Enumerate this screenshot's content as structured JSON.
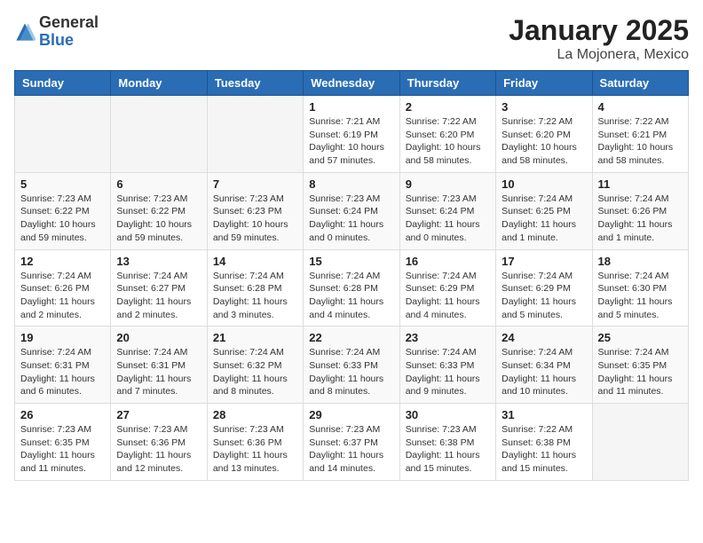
{
  "logo": {
    "general": "General",
    "blue": "Blue"
  },
  "title": "January 2025",
  "subtitle": "La Mojonera, Mexico",
  "days_of_week": [
    "Sunday",
    "Monday",
    "Tuesday",
    "Wednesday",
    "Thursday",
    "Friday",
    "Saturday"
  ],
  "weeks": [
    [
      {
        "day": "",
        "info": ""
      },
      {
        "day": "",
        "info": ""
      },
      {
        "day": "",
        "info": ""
      },
      {
        "day": "1",
        "info": "Sunrise: 7:21 AM\nSunset: 6:19 PM\nDaylight: 10 hours and 57 minutes."
      },
      {
        "day": "2",
        "info": "Sunrise: 7:22 AM\nSunset: 6:20 PM\nDaylight: 10 hours and 58 minutes."
      },
      {
        "day": "3",
        "info": "Sunrise: 7:22 AM\nSunset: 6:20 PM\nDaylight: 10 hours and 58 minutes."
      },
      {
        "day": "4",
        "info": "Sunrise: 7:22 AM\nSunset: 6:21 PM\nDaylight: 10 hours and 58 minutes."
      }
    ],
    [
      {
        "day": "5",
        "info": "Sunrise: 7:23 AM\nSunset: 6:22 PM\nDaylight: 10 hours and 59 minutes."
      },
      {
        "day": "6",
        "info": "Sunrise: 7:23 AM\nSunset: 6:22 PM\nDaylight: 10 hours and 59 minutes."
      },
      {
        "day": "7",
        "info": "Sunrise: 7:23 AM\nSunset: 6:23 PM\nDaylight: 10 hours and 59 minutes."
      },
      {
        "day": "8",
        "info": "Sunrise: 7:23 AM\nSunset: 6:24 PM\nDaylight: 11 hours and 0 minutes."
      },
      {
        "day": "9",
        "info": "Sunrise: 7:23 AM\nSunset: 6:24 PM\nDaylight: 11 hours and 0 minutes."
      },
      {
        "day": "10",
        "info": "Sunrise: 7:24 AM\nSunset: 6:25 PM\nDaylight: 11 hours and 1 minute."
      },
      {
        "day": "11",
        "info": "Sunrise: 7:24 AM\nSunset: 6:26 PM\nDaylight: 11 hours and 1 minute."
      }
    ],
    [
      {
        "day": "12",
        "info": "Sunrise: 7:24 AM\nSunset: 6:26 PM\nDaylight: 11 hours and 2 minutes."
      },
      {
        "day": "13",
        "info": "Sunrise: 7:24 AM\nSunset: 6:27 PM\nDaylight: 11 hours and 2 minutes."
      },
      {
        "day": "14",
        "info": "Sunrise: 7:24 AM\nSunset: 6:28 PM\nDaylight: 11 hours and 3 minutes."
      },
      {
        "day": "15",
        "info": "Sunrise: 7:24 AM\nSunset: 6:28 PM\nDaylight: 11 hours and 4 minutes."
      },
      {
        "day": "16",
        "info": "Sunrise: 7:24 AM\nSunset: 6:29 PM\nDaylight: 11 hours and 4 minutes."
      },
      {
        "day": "17",
        "info": "Sunrise: 7:24 AM\nSunset: 6:29 PM\nDaylight: 11 hours and 5 minutes."
      },
      {
        "day": "18",
        "info": "Sunrise: 7:24 AM\nSunset: 6:30 PM\nDaylight: 11 hours and 5 minutes."
      }
    ],
    [
      {
        "day": "19",
        "info": "Sunrise: 7:24 AM\nSunset: 6:31 PM\nDaylight: 11 hours and 6 minutes."
      },
      {
        "day": "20",
        "info": "Sunrise: 7:24 AM\nSunset: 6:31 PM\nDaylight: 11 hours and 7 minutes."
      },
      {
        "day": "21",
        "info": "Sunrise: 7:24 AM\nSunset: 6:32 PM\nDaylight: 11 hours and 8 minutes."
      },
      {
        "day": "22",
        "info": "Sunrise: 7:24 AM\nSunset: 6:33 PM\nDaylight: 11 hours and 8 minutes."
      },
      {
        "day": "23",
        "info": "Sunrise: 7:24 AM\nSunset: 6:33 PM\nDaylight: 11 hours and 9 minutes."
      },
      {
        "day": "24",
        "info": "Sunrise: 7:24 AM\nSunset: 6:34 PM\nDaylight: 11 hours and 10 minutes."
      },
      {
        "day": "25",
        "info": "Sunrise: 7:24 AM\nSunset: 6:35 PM\nDaylight: 11 hours and 11 minutes."
      }
    ],
    [
      {
        "day": "26",
        "info": "Sunrise: 7:23 AM\nSunset: 6:35 PM\nDaylight: 11 hours and 11 minutes."
      },
      {
        "day": "27",
        "info": "Sunrise: 7:23 AM\nSunset: 6:36 PM\nDaylight: 11 hours and 12 minutes."
      },
      {
        "day": "28",
        "info": "Sunrise: 7:23 AM\nSunset: 6:36 PM\nDaylight: 11 hours and 13 minutes."
      },
      {
        "day": "29",
        "info": "Sunrise: 7:23 AM\nSunset: 6:37 PM\nDaylight: 11 hours and 14 minutes."
      },
      {
        "day": "30",
        "info": "Sunrise: 7:23 AM\nSunset: 6:38 PM\nDaylight: 11 hours and 15 minutes."
      },
      {
        "day": "31",
        "info": "Sunrise: 7:22 AM\nSunset: 6:38 PM\nDaylight: 11 hours and 15 minutes."
      },
      {
        "day": "",
        "info": ""
      }
    ]
  ]
}
